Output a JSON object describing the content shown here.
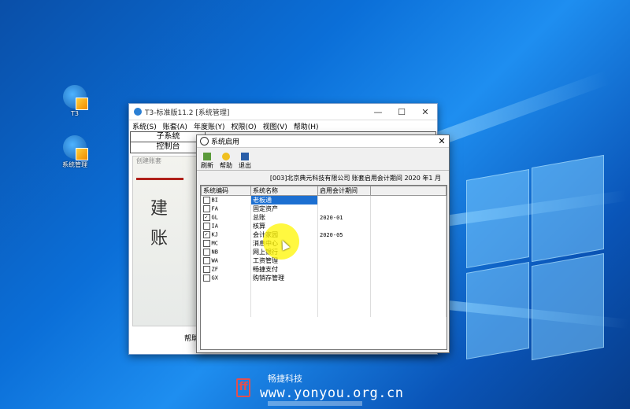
{
  "desktop": {
    "icons": [
      {
        "label": "T3",
        "icon": "t3-app-icon"
      },
      {
        "label": "系统管理",
        "icon": "system-admin-icon"
      }
    ]
  },
  "main_window": {
    "title": "T3-标准版11.2 [系统管理]",
    "minimize": "—",
    "maximize": "☐",
    "close": "✕",
    "menu": [
      "系统(S)",
      "账套(A)",
      "年度账(Y)",
      "权限(O)",
      "视图(V)",
      "帮助(H)"
    ],
    "tabs": {
      "subsystem": "子系统",
      "console": "控制台"
    },
    "banner_caption": "创建账套",
    "banner_char_1": "建",
    "banner_char_2": "账",
    "help_button": "帮助"
  },
  "dialog": {
    "title": "系统启用",
    "close": "✕",
    "toolbar": [
      {
        "label": "刷新",
        "icon": "refresh-icon"
      },
      {
        "label": "帮助",
        "icon": "help-bulb-icon"
      },
      {
        "label": "退出",
        "icon": "exit-icon"
      }
    ],
    "info": "[003]北京典元科技有限公司 账套启用会计期间 2020 年1 月",
    "columns": [
      "系统编码",
      "系统名称",
      "启用会计期间"
    ],
    "rows": [
      {
        "code": "BI",
        "name": "老板通",
        "period": "",
        "checked": false,
        "selected": true
      },
      {
        "code": "FA",
        "name": "固定资产",
        "period": "",
        "checked": false,
        "selected": false
      },
      {
        "code": "GL",
        "name": "总账",
        "period": "2020-01",
        "checked": true,
        "selected": false
      },
      {
        "code": "IA",
        "name": "核算",
        "period": "",
        "checked": false,
        "selected": false
      },
      {
        "code": "KJ",
        "name": "会计家园",
        "period": "2020-05",
        "checked": true,
        "selected": false
      },
      {
        "code": "MC",
        "name": "消息中心",
        "period": "",
        "checked": false,
        "selected": false
      },
      {
        "code": "NB",
        "name": "网上银行",
        "period": "",
        "checked": false,
        "selected": false
      },
      {
        "code": "WA",
        "name": "工资管理",
        "period": "",
        "checked": false,
        "selected": false
      },
      {
        "code": "ZF",
        "name": "畅捷支付",
        "period": "",
        "checked": false,
        "selected": false
      },
      {
        "code": "GX",
        "name": "购销存管理",
        "period": "",
        "checked": false,
        "selected": false
      }
    ]
  },
  "watermark": {
    "brand_cn": "畅捷科技",
    "url": "www.yonyou.org.cn"
  },
  "colors": {
    "selection": "#1c6fd1",
    "cursor_highlight": "#fff500"
  }
}
